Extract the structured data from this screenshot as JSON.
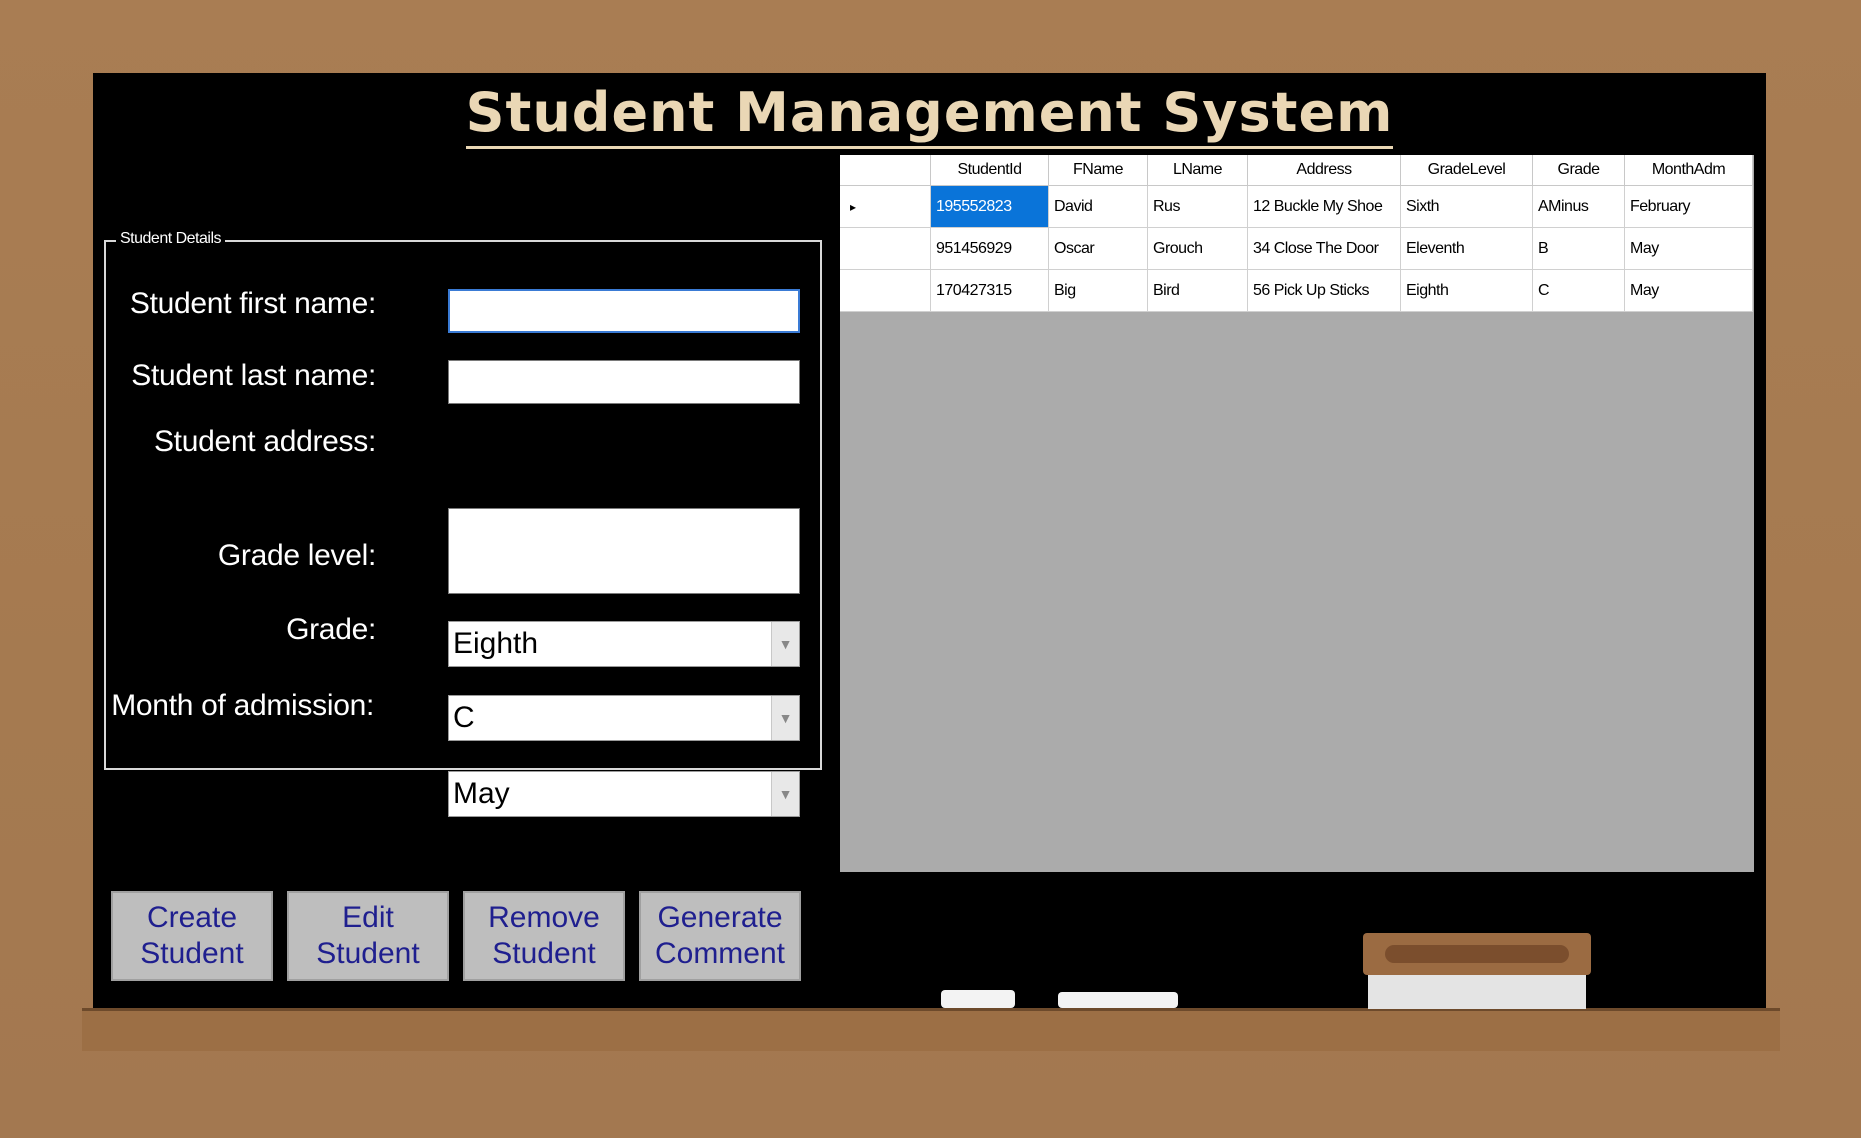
{
  "app": {
    "title": "Student Management System"
  },
  "details": {
    "legend": "Student Details",
    "first_name_label": "Student first name:",
    "last_name_label": "Student last name:",
    "address_label": "Student address:",
    "grade_level_label": "Grade level:",
    "grade_label": "Grade:",
    "month_label": "Month of admission:",
    "first_name_value": "",
    "last_name_value": "",
    "address_value": "",
    "grade_level_value": "Eighth",
    "grade_value": "C",
    "month_value": "May"
  },
  "grid": {
    "columns": [
      "StudentId",
      "FName",
      "LName",
      "Address",
      "GradeLevel",
      "Grade",
      "MonthAdm"
    ],
    "rows": [
      [
        "195552823",
        "David",
        "Rus",
        "12 Buckle My Shoe",
        "Sixth",
        "AMinus",
        "February"
      ],
      [
        "951456929",
        "Oscar",
        "Grouch",
        "34 Close The Door",
        "Eleventh",
        "B",
        "May"
      ],
      [
        "170427315",
        "Big",
        "Bird",
        "56 Pick Up Sticks",
        "Eighth",
        "C",
        "May"
      ]
    ],
    "row_pointer": "▸"
  },
  "buttons": {
    "create": "Create\nStudent",
    "edit": "Edit\nStudent",
    "remove": "Remove\nStudent",
    "comment": "Generate\nComment"
  },
  "colors": {
    "board": "#000000",
    "frame": "#a87c52",
    "title": "#ead7b5",
    "button_text": "#1f1f8f",
    "selection": "#0a74d9"
  }
}
